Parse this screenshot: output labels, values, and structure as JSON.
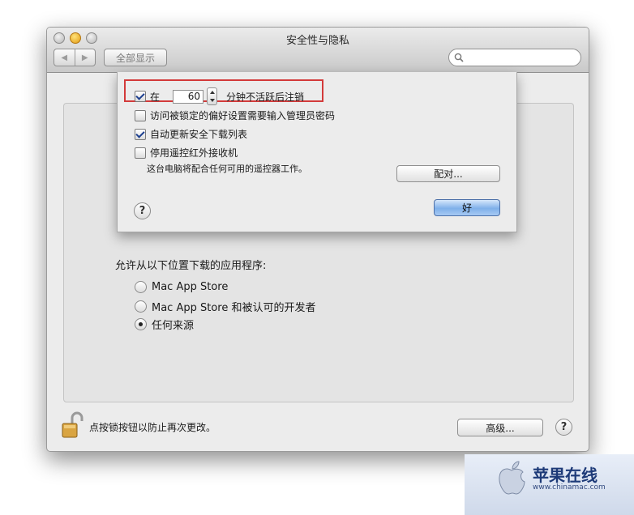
{
  "window": {
    "title": "安全性与隐私"
  },
  "toolbar": {
    "back_glyph": "◀",
    "forward_glyph": "▶",
    "show_all": "全部显示",
    "search_icon": "magnifier-icon"
  },
  "sheet": {
    "row1": {
      "prefix": "在",
      "minutes": "60",
      "suffix": "分钟不活跃后注销",
      "checked": true
    },
    "row2": {
      "label": "访问被锁定的偏好设置需要输入管理员密码",
      "checked": false
    },
    "row3": {
      "label": "自动更新安全下载列表",
      "checked": true
    },
    "row4": {
      "label": "停用遥控红外接收机",
      "checked": false
    },
    "note": "这台电脑将配合任何可用的遥控器工作。",
    "pair_button": "配对...",
    "ok_button": "好",
    "help": "?"
  },
  "main": {
    "allow_label": "允许从以下位置下载的应用程序:",
    "options": [
      {
        "label": "Mac App Store",
        "selected": false
      },
      {
        "label": "Mac App Store 和被认可的开发者",
        "selected": false
      },
      {
        "label": "任何来源",
        "selected": true
      }
    ]
  },
  "footer": {
    "lock_text": "点按锁按钮以防止再次更改。",
    "advanced_button": "高级...",
    "help": "?"
  },
  "watermark": {
    "title": "苹果在线",
    "url": "www.chinamac.com"
  },
  "colors": {
    "highlight": "#d33a3a",
    "default_button": "#7fb0ea"
  }
}
